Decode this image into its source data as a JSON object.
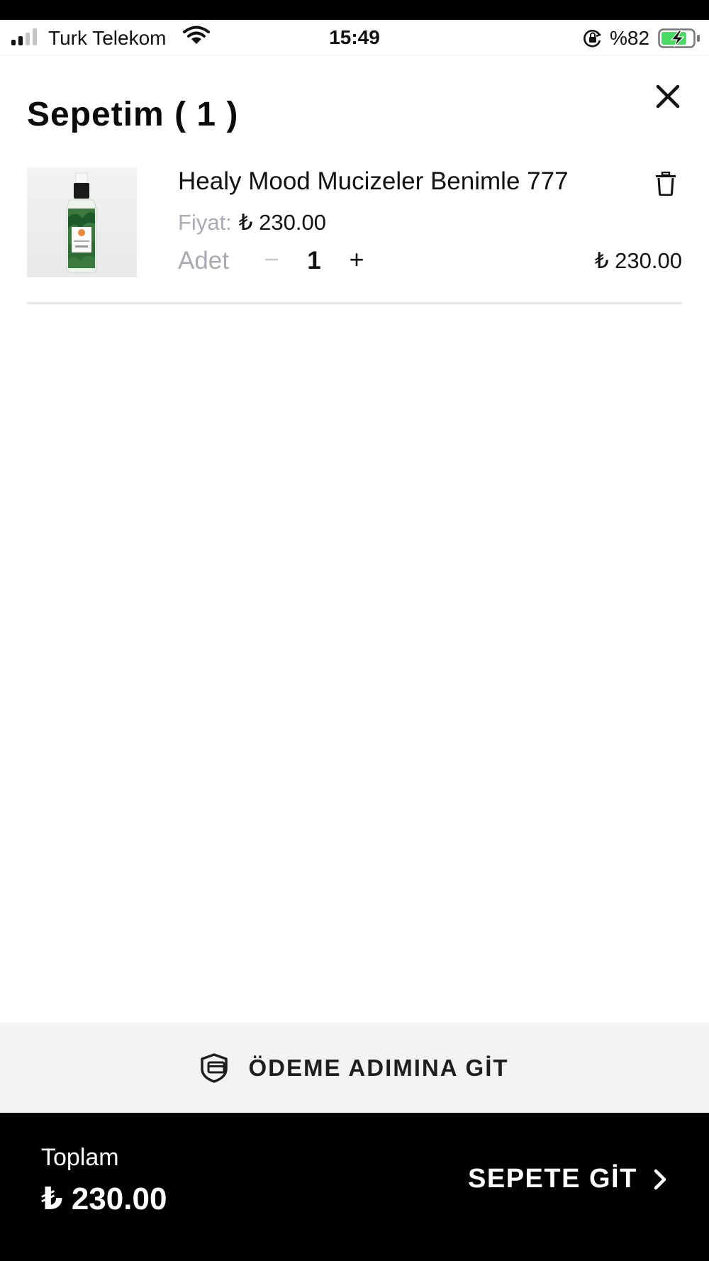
{
  "status_bar": {
    "carrier": "Turk Telekom",
    "time": "15:49",
    "battery_percent": "%82",
    "signal_bars_active": 2,
    "signal_bars_total": 4,
    "battery_level": 0.82,
    "battery_charging": true,
    "battery_color": "#4cd964",
    "icons": [
      "signal-icon",
      "wifi-icon",
      "orientation-lock-icon",
      "battery-icon"
    ]
  },
  "cart": {
    "title": "Sepetim ( 1 )",
    "close_icon": "close-icon",
    "items": [
      {
        "name": "Healy Mood Mucizeler Benimle 777",
        "price_label": "Fiyat:",
        "price": "₺ 230.00",
        "quantity_label": "Adet",
        "decrement": "−",
        "quantity": "1",
        "increment": "+",
        "line_total": "₺ 230.00",
        "delete_icon": "trash-icon"
      }
    ]
  },
  "checkout_step": {
    "label": "ÖDEME ADIMINA GİT",
    "icon": "payment-icon"
  },
  "footer": {
    "total_label": "Toplam",
    "total_value": "₺ 230.00",
    "go_to_cart_label": "SEPETE GİT",
    "chevron_icon": "chevron-right-icon"
  },
  "colors": {
    "footer_background": "#000000",
    "checkout_background": "#f3f3f3",
    "muted_text": "#a9abb3"
  }
}
